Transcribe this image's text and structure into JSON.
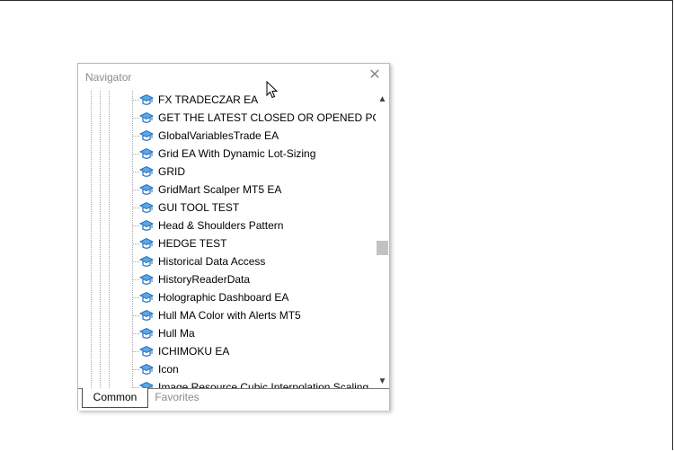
{
  "navigator": {
    "title": "Navigator",
    "close_label": "✕",
    "items": [
      {
        "label": "FX TRADECZAR EA",
        "icon": "ea-icon"
      },
      {
        "label": "GET THE LATEST CLOSED OR OPENED POSITIC",
        "icon": "ea-icon"
      },
      {
        "label": "GlobalVariablesTrade EA",
        "icon": "ea-icon"
      },
      {
        "label": "Grid EA With Dynamic Lot-Sizing",
        "icon": "ea-icon"
      },
      {
        "label": "GRID",
        "icon": "ea-icon"
      },
      {
        "label": "GridMart Scalper MT5 EA",
        "icon": "ea-icon"
      },
      {
        "label": "GUI TOOL TEST",
        "icon": "ea-icon"
      },
      {
        "label": "Head & Shoulders Pattern",
        "icon": "ea-icon"
      },
      {
        "label": "HEDGE TEST",
        "icon": "ea-icon"
      },
      {
        "label": "Historical Data Access",
        "icon": "ea-icon"
      },
      {
        "label": "HistoryReaderData",
        "icon": "ea-icon"
      },
      {
        "label": "Holographic Dashboard EA",
        "icon": "ea-icon"
      },
      {
        "label": "Hull MA Color with Alerts MT5",
        "icon": "ea-icon"
      },
      {
        "label": "Hull Ma",
        "icon": "ea-icon"
      },
      {
        "label": "ICHIMOKU EA",
        "icon": "ea-icon"
      },
      {
        "label": "Icon",
        "icon": "ea-icon"
      },
      {
        "label": "Image Resource Cubic Interpolation Scaling",
        "icon": "ea-icon"
      }
    ],
    "scroll": {
      "up_icon": "▲",
      "down_icon": "▼",
      "position_fraction": 0.53
    },
    "tabs": [
      {
        "label": "Common",
        "active": true
      },
      {
        "label": "Favorites",
        "active": false
      }
    ]
  },
  "colors": {
    "icon_blue": "#1f6fbf",
    "icon_light": "#5aa8e8",
    "title_gray": "#8c8c8c",
    "thumb_gray": "#c2c2c2"
  }
}
